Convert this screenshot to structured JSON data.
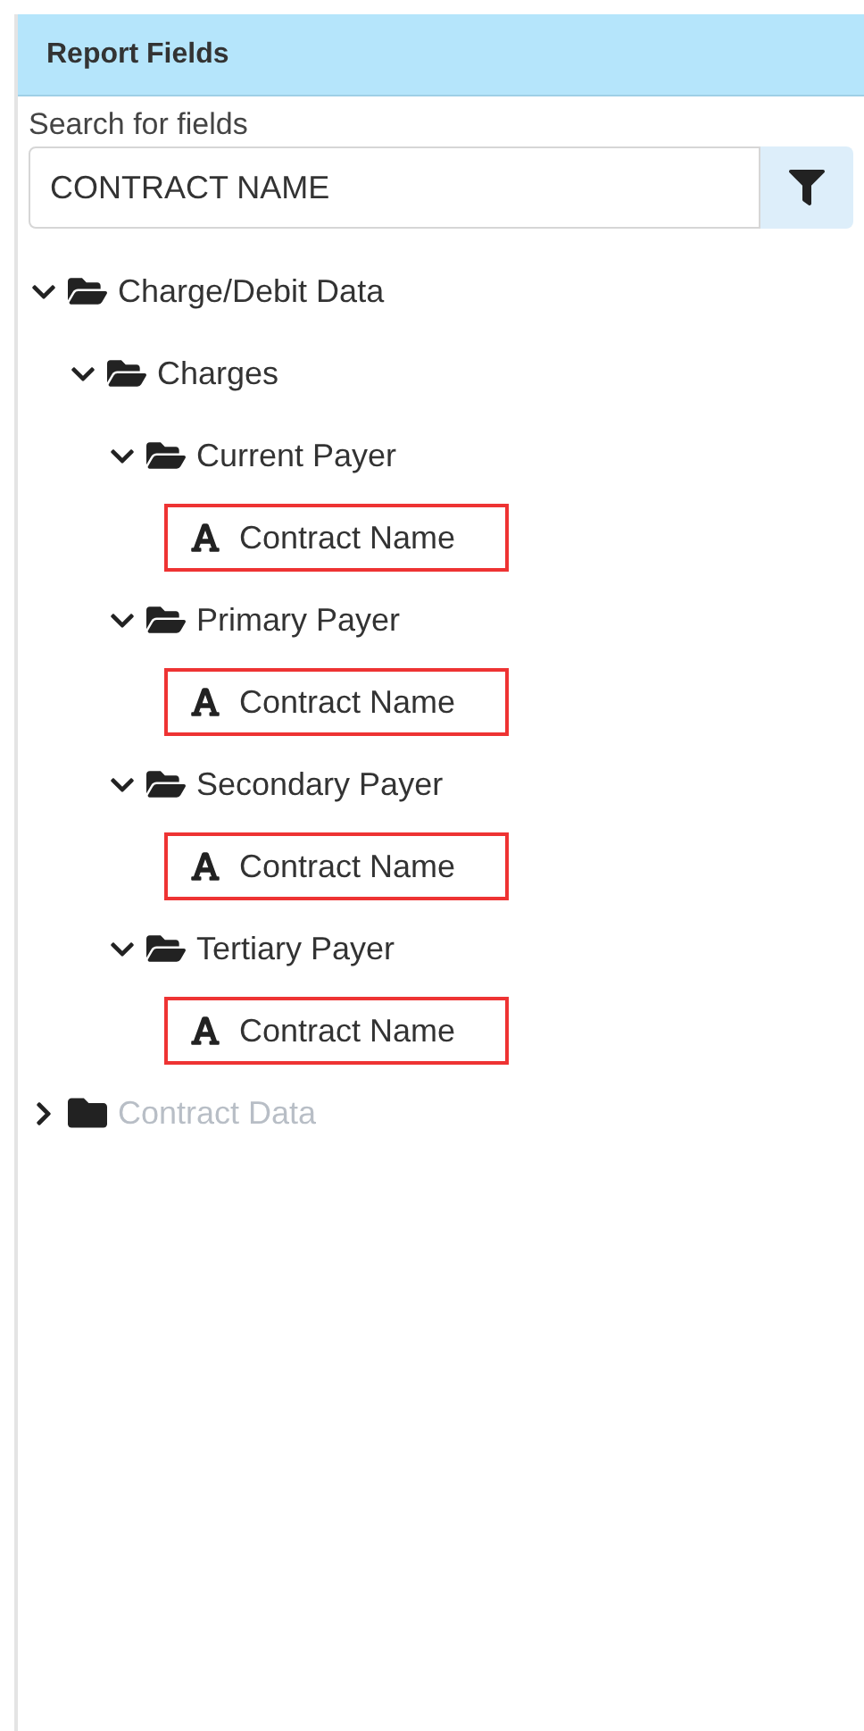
{
  "panel": {
    "title": "Report Fields"
  },
  "search": {
    "label": "Search for fields",
    "value": "CONTRACT NAME"
  },
  "tree": [
    {
      "kind": "folder",
      "label": "Charge/Debit Data",
      "expanded": true,
      "dimmed": false,
      "children": [
        {
          "kind": "folder",
          "label": "Charges",
          "expanded": true,
          "dimmed": false,
          "children": [
            {
              "kind": "folder",
              "label": "Current Payer",
              "expanded": true,
              "dimmed": false,
              "children": [
                {
                  "kind": "field",
                  "label": "Contract Name",
                  "highlighted": true
                }
              ]
            },
            {
              "kind": "folder",
              "label": "Primary Payer",
              "expanded": true,
              "dimmed": false,
              "children": [
                {
                  "kind": "field",
                  "label": "Contract Name",
                  "highlighted": true
                }
              ]
            },
            {
              "kind": "folder",
              "label": "Secondary Payer",
              "expanded": true,
              "dimmed": false,
              "children": [
                {
                  "kind": "field",
                  "label": "Contract Name",
                  "highlighted": true
                }
              ]
            },
            {
              "kind": "folder",
              "label": "Tertiary Payer",
              "expanded": true,
              "dimmed": false,
              "children": [
                {
                  "kind": "field",
                  "label": "Contract Name",
                  "highlighted": true
                }
              ]
            }
          ]
        }
      ]
    },
    {
      "kind": "folder",
      "label": "Contract Data",
      "expanded": false,
      "dimmed": true
    }
  ]
}
